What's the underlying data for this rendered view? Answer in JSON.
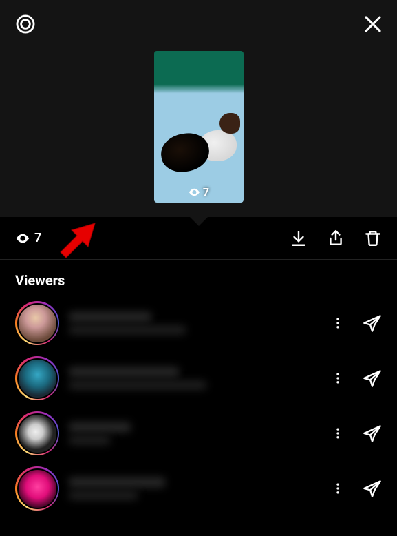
{
  "header": {
    "settings_icon": "settings-gear",
    "close_icon": "close-x"
  },
  "story_preview": {
    "view_count_on_thumb": "7"
  },
  "action_bar": {
    "view_count": "7",
    "download_icon": "download",
    "share_icon": "share",
    "delete_icon": "trash"
  },
  "viewers_section": {
    "title": "Viewers",
    "items": [
      {
        "username": "",
        "display_name": "",
        "avatar": "av1"
      },
      {
        "username": "",
        "display_name": "",
        "avatar": "av2"
      },
      {
        "username": "",
        "display_name": "",
        "avatar": "av3"
      },
      {
        "username": "",
        "display_name": "",
        "avatar": "av4"
      }
    ]
  },
  "annotation": {
    "type": "red-arrow",
    "points_to": "view-count"
  }
}
